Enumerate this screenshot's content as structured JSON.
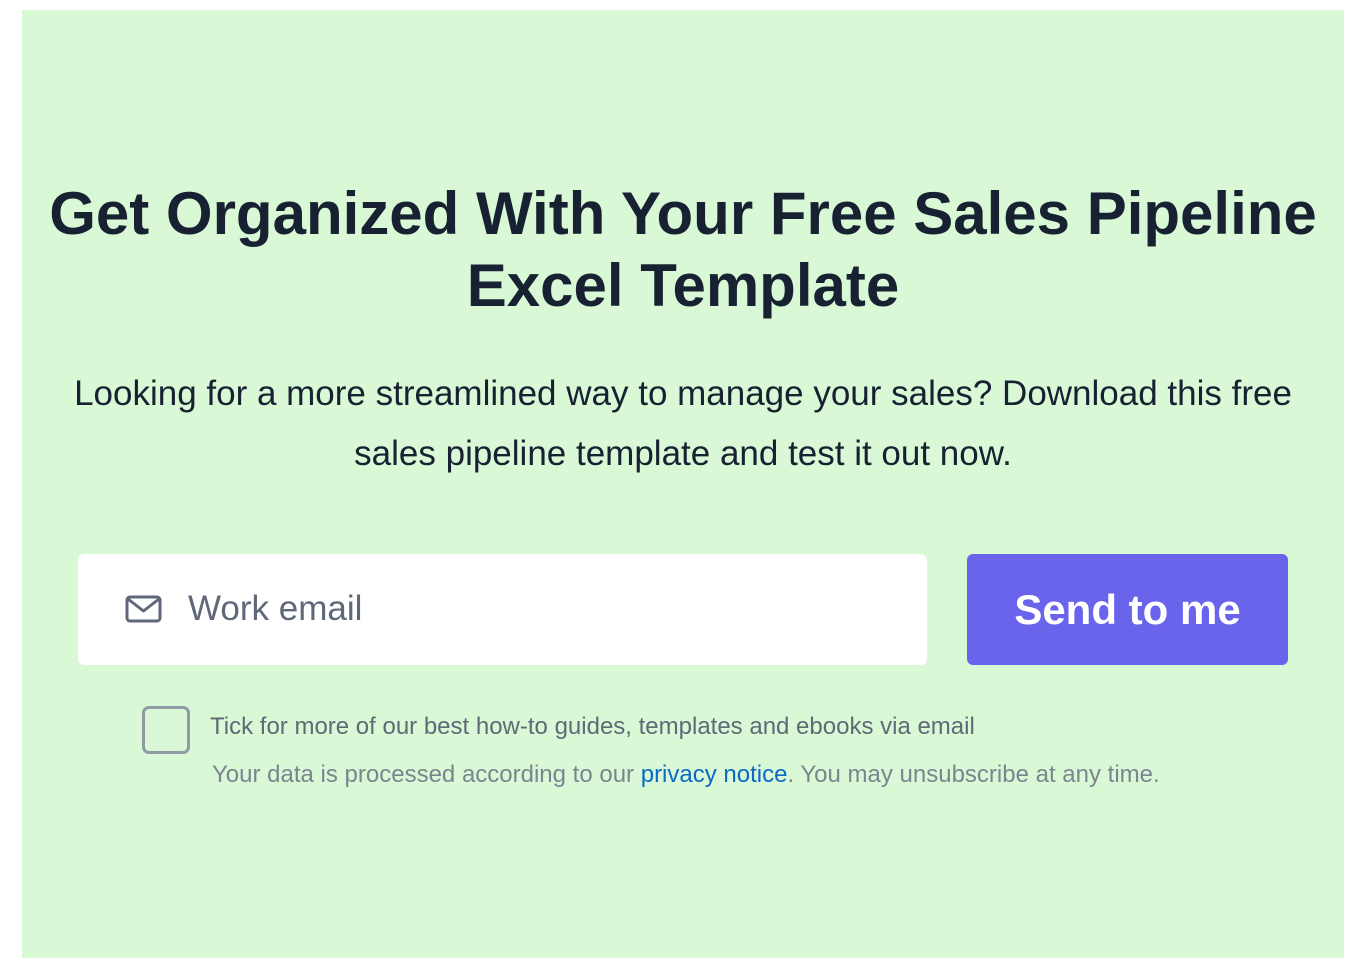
{
  "hero": {
    "title": "Get Organized With Your Free Sales Pipeline Excel Template",
    "subtitle": "Looking for a more streamlined way to manage your sales? Download this free sales pipeline template and test it out now."
  },
  "form": {
    "email_icon": "mail-icon",
    "email_placeholder": "Work email",
    "email_value": "",
    "submit_label": "Send to me",
    "checkbox_checked": false,
    "checkbox_label": "Tick for more of our best how-to guides, templates and ebooks via email",
    "notice_prefix": "Your data is processed according to our ",
    "privacy_link": "privacy notice",
    "notice_suffix": ". You may unsubscribe at any time."
  },
  "colors": {
    "panel_background": "#d8f8d6",
    "heading_text": "#172131",
    "button_background": "#6a63ec",
    "link": "#0a6ac6"
  }
}
